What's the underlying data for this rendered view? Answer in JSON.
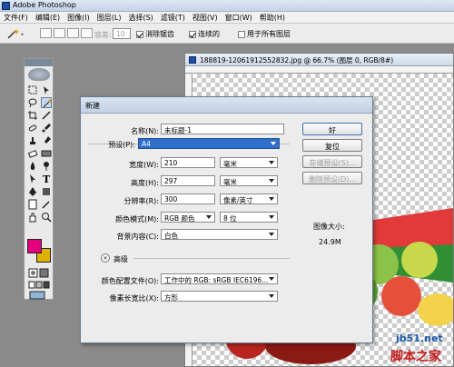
{
  "app": {
    "title": "Adobe Photoshop"
  },
  "menu": [
    "文件(F)",
    "编辑(E)",
    "图像(I)",
    "图层(L)",
    "选择(S)",
    "滤镜(T)",
    "视图(V)",
    "窗口(W)",
    "帮助(H)"
  ],
  "options": {
    "feather_label": "容差:",
    "feather_value": "10",
    "antialias_label": "消除锯齿",
    "contiguous_label": "连续的",
    "all_layers_label": "用于所有图层"
  },
  "document": {
    "title": "188819-12061912552832.jpg @ 66.7% (图层 0, RGB/8#)"
  },
  "dialog": {
    "title": "新建",
    "name_label": "名称(N):",
    "name_value": "未标题-1",
    "preset_label": "预设(P):",
    "preset_value": "A4",
    "width_label": "宽度(W):",
    "width_value": "210",
    "width_unit": "毫米",
    "height_label": "高度(H):",
    "height_value": "297",
    "height_unit": "毫米",
    "resolution_label": "分辨率(R):",
    "resolution_value": "300",
    "resolution_unit": "像素/英寸",
    "colormode_label": "颜色模式(M):",
    "colormode_value": "RGB 颜色",
    "bitdepth_value": "8 位",
    "background_label": "背景内容(C):",
    "background_value": "白色",
    "advanced_label": "高级",
    "profile_label": "颜色配置文件(O):",
    "profile_value": "工作中的 RGB: sRGB IEC6196...",
    "pixel_aspect_label": "像素长宽比(X):",
    "pixel_aspect_value": "方形",
    "ok_label": "好",
    "reset_label": "复位",
    "save_preset_label": "存储预设(S)...",
    "delete_preset_label": "删除预设(D)...",
    "image_size_label": "图像大小:",
    "image_size_value": "24.9M"
  },
  "watermark": {
    "site": "jb51.net",
    "brand": "脚本之家"
  },
  "colors": {
    "foreground": "#e6007e",
    "background": "#e0b000",
    "accent": "#2f6fcc"
  }
}
